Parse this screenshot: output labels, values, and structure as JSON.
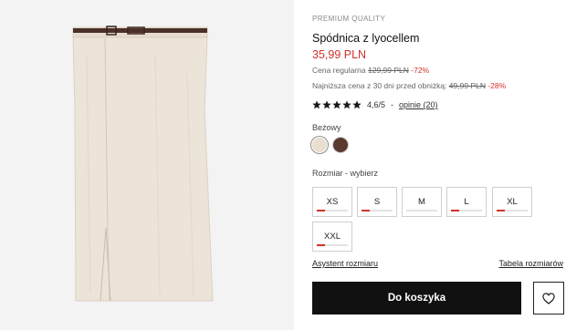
{
  "product": {
    "eyebrow": "PREMIUM QUALITY",
    "title": "Spódnica z lyocellem",
    "price": "35,99 PLN",
    "regular_label": "Cena regularna",
    "regular_price": "129,99 PLN",
    "regular_discount": "-72%",
    "lowest_label": "Najniższa cena z 30 dni przed obniżką:",
    "lowest_price": "49,99 PLN",
    "lowest_discount": "-28%"
  },
  "rating": {
    "score": "4,6/5",
    "separator": "-",
    "reviews_link": "opinie (20)",
    "stars_filled": 5
  },
  "color": {
    "label": "Beżowy",
    "swatches": [
      {
        "name": "beige",
        "hex": "#eadfcf",
        "selected": true
      },
      {
        "name": "brown",
        "hex": "#5a3a30",
        "selected": false
      }
    ]
  },
  "size": {
    "label": "Rozmiar -  wybierz",
    "options": [
      {
        "label": "XS",
        "stock_fraction": 0.25
      },
      {
        "label": "S",
        "stock_fraction": 0.25
      },
      {
        "label": "M",
        "stock_fraction": 0
      },
      {
        "label": "L",
        "stock_fraction": 0.25
      },
      {
        "label": "XL",
        "stock_fraction": 0.25
      },
      {
        "label": "XXL",
        "stock_fraction": 0.25
      }
    ]
  },
  "links": {
    "assistant": "Asystent rozmiaru",
    "size_table": "Tabela rozmiarów"
  },
  "actions": {
    "add_to_cart": "Do koszyka"
  },
  "colors": {
    "accent_red": "#d0312d",
    "button_black": "#111111"
  }
}
